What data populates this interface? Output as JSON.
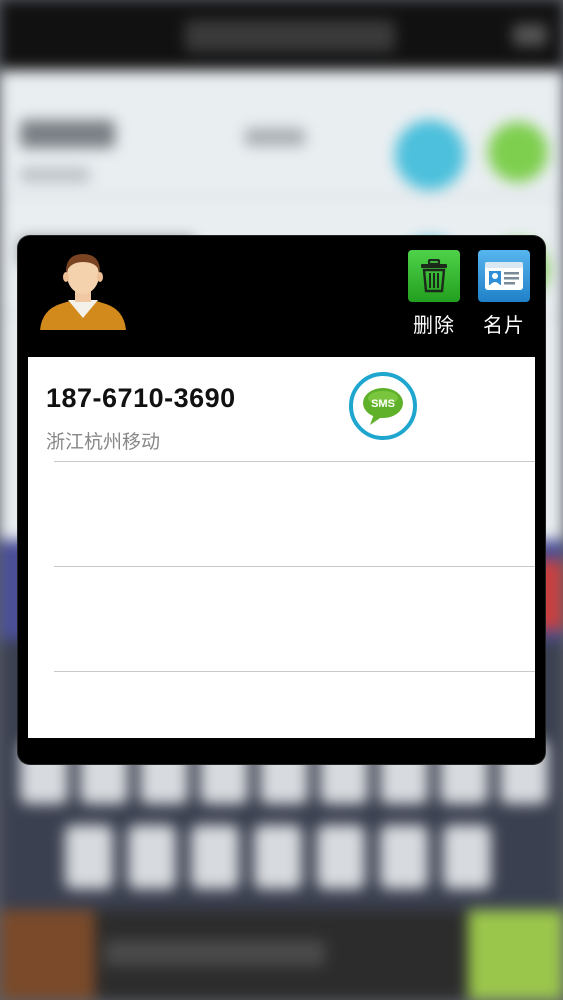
{
  "popup": {
    "actions": [
      {
        "label": "删除",
        "icon": "trash-icon",
        "color": "#34b92f"
      },
      {
        "label": "名片",
        "icon": "contact-card-icon",
        "color": "#3497dc"
      }
    ],
    "contact": {
      "number": "187-6710-3690",
      "location": "浙江杭州移动",
      "sms_icon_text": "SMS"
    }
  }
}
